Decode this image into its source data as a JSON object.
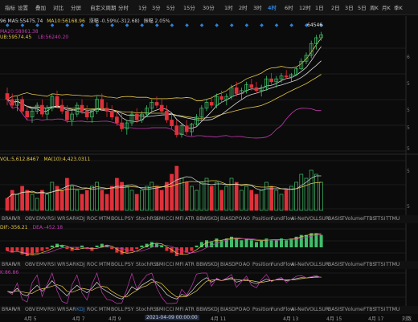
{
  "toolbar": {
    "items": [
      "指标",
      "设置",
      "叠加",
      "对比",
      "分屏",
      "自定义周期",
      "分时",
      "1分",
      "3分",
      "5分",
      "15分",
      "30分",
      "1时",
      "2时",
      "3时",
      "4时",
      "6时",
      "12时",
      "1日",
      "2日",
      "3日",
      "5日",
      "周K",
      "月K",
      "季K"
    ],
    "active": "4时"
  },
  "main_info": {
    "line1a": "96 MA5:55475.74",
    "line1b": "MA10:56168.96",
    "line1c": "涨幅 -0.59%(-312.68)",
    "line1d": "振幅 2.05%",
    "line2": "MA20:58061.38",
    "line3a": "UB:59574.45",
    "line3b": "LB:56240.20",
    "high_label": "64546"
  },
  "vol_info": {
    "a": "VOL:5,612.8467",
    "b": "MA(10):4,423.0311"
  },
  "macd_info": {
    "a": "DIF:-356.21",
    "b": "DEA:-452.18"
  },
  "kdj_info": {
    "a": "K:86.86"
  },
  "indicators": [
    "BRAR",
    "VR",
    "OBV",
    "EMV",
    "RSI",
    "WR",
    "SAR",
    "KDJ",
    "ROC",
    "MTM",
    "BOLL",
    "PSY",
    "StochRSI",
    "SMI",
    "CCI",
    "MFI",
    "ATR",
    "BBW",
    "SKDJ",
    "BIAS",
    "DPO",
    "AO",
    "Position",
    "FundFlow",
    "Ai-NetVOL",
    "LSUR",
    "BASIS",
    "TVolume",
    "FTBS",
    "TTSI",
    "TTMU"
  ],
  "ind_row1_selected": "VOL",
  "ind_row2_selected": "MACD",
  "ind_row3_selected": "KDJ",
  "yaxis": [
    "6",
    "5",
    "5",
    "5",
    "5",
    "5",
    "5"
  ],
  "dates": [
    "4月 5",
    "4月 7",
    "4月 9",
    "2021-04-09 00:00:00",
    "4月 11",
    "4月 13",
    "4月 15",
    "4月 17",
    "刘数"
  ],
  "colors": {
    "up": "#3fbf6a",
    "down": "#e0303a",
    "ma5": "#d9d9d9",
    "ma10": "#e6c84a",
    "ma20": "#c23bb0",
    "accent": "#2f7fd6"
  },
  "chart_data": {
    "type": "candlestick",
    "candles": [
      [
        60,
        61,
        58,
        59
      ],
      [
        59,
        60,
        57.5,
        58
      ],
      [
        58,
        59.5,
        57,
        59
      ],
      [
        59,
        59.5,
        56.5,
        57
      ],
      [
        57,
        58,
        55.5,
        56
      ],
      [
        56,
        57.5,
        55,
        57
      ],
      [
        57,
        58.5,
        56.5,
        58
      ],
      [
        58,
        59,
        56,
        56.5
      ],
      [
        56.5,
        58,
        55.5,
        57.5
      ],
      [
        57.5,
        60,
        57,
        59.5
      ],
      [
        59.5,
        60.5,
        57.5,
        58
      ],
      [
        58,
        59,
        56.5,
        57
      ],
      [
        57,
        58,
        55,
        55.5
      ],
      [
        55.5,
        57,
        54.5,
        56.5
      ],
      [
        56.5,
        58.5,
        56,
        58
      ],
      [
        58,
        59,
        56.5,
        57
      ],
      [
        57,
        58,
        55.5,
        56
      ],
      [
        56,
        57.5,
        55,
        57
      ],
      [
        57,
        59.5,
        56.5,
        59
      ],
      [
        59,
        60,
        57,
        57.5
      ],
      [
        57.5,
        58.5,
        56,
        57
      ],
      [
        57,
        58,
        55.5,
        56
      ],
      [
        56,
        57,
        54.5,
        55
      ],
      [
        55,
        56.5,
        53.5,
        54
      ],
      [
        54,
        55.5,
        53,
        55
      ],
      [
        55,
        57,
        54.5,
        56.5
      ],
      [
        56.5,
        57.5,
        55,
        55.5
      ],
      [
        55.5,
        57,
        55,
        56.5
      ],
      [
        56.5,
        58,
        56,
        57.5
      ],
      [
        57.5,
        59,
        57,
        58.5
      ],
      [
        58.5,
        59.5,
        57.5,
        58
      ],
      [
        58,
        59,
        56.5,
        57
      ],
      [
        57,
        58,
        55,
        55.5
      ],
      [
        55.5,
        56.5,
        54,
        54.5
      ],
      [
        54.5,
        55.5,
        52.5,
        53
      ],
      [
        53,
        55,
        52.5,
        54.5
      ],
      [
        54.5,
        55.5,
        53,
        53.5
      ],
      [
        53.5,
        55,
        52.8,
        54.8
      ],
      [
        54.8,
        56.5,
        54.5,
        56
      ],
      [
        56,
        58,
        55.5,
        57.5
      ],
      [
        57.5,
        59,
        57,
        58.5
      ],
      [
        58.5,
        59.5,
        57.5,
        58
      ],
      [
        58,
        60,
        57.5,
        59.5
      ],
      [
        59.5,
        60.5,
        58.5,
        59
      ],
      [
        59,
        60,
        58,
        59.5
      ],
      [
        59.5,
        61.5,
        59,
        61
      ],
      [
        61,
        62,
        59.5,
        60
      ],
      [
        60,
        61,
        59,
        60.5
      ],
      [
        60.5,
        62,
        60,
        61.5
      ],
      [
        61.5,
        62.5,
        60.5,
        61
      ],
      [
        61,
        62,
        60,
        60.5
      ],
      [
        60.5,
        61.5,
        59.5,
        61
      ],
      [
        61,
        63,
        60.5,
        62.5
      ],
      [
        62.5,
        63.5,
        61.5,
        62
      ],
      [
        62,
        63,
        61,
        62.5
      ],
      [
        62.5,
        63.5,
        61.8,
        63
      ],
      [
        63,
        64,
        62.5,
        62.8
      ],
      [
        62.8,
        63.5,
        62,
        63.2
      ],
      [
        63.2,
        64.5,
        63,
        64.2
      ],
      [
        64.2,
        66,
        64,
        65.5
      ],
      [
        65.5,
        67,
        65,
        66.5
      ],
      [
        66.5,
        69,
        66,
        68.5
      ],
      [
        68.5,
        70,
        67.5,
        69.5
      ],
      [
        69.5,
        70.5,
        69,
        70
      ]
    ],
    "volume": [
      3,
      5,
      4,
      6,
      5,
      4,
      3,
      5,
      4,
      7,
      6,
      5,
      8,
      6,
      5,
      4,
      5,
      6,
      7,
      5,
      4,
      6,
      8,
      7,
      6,
      5,
      4,
      5,
      6,
      7,
      6,
      5,
      7,
      9,
      11,
      8,
      7,
      6,
      5,
      7,
      8,
      6,
      7,
      5,
      6,
      8,
      7,
      5,
      6,
      5,
      4,
      5,
      7,
      6,
      5,
      4,
      5,
      6,
      7,
      9,
      8,
      10,
      9,
      7
    ],
    "macd": [
      -2,
      -3,
      -2,
      -4,
      -5,
      -4,
      -3,
      -2,
      -1,
      1,
      2,
      1,
      -1,
      -2,
      -1,
      1,
      -1,
      -2,
      1,
      2,
      1,
      -1,
      -3,
      -4,
      -3,
      -2,
      -1,
      1,
      2,
      3,
      2,
      1,
      -2,
      -3,
      -5,
      -4,
      -3,
      -2,
      1,
      3,
      4,
      3,
      5,
      4,
      5,
      6,
      5,
      4,
      5,
      4,
      3,
      4,
      5,
      4,
      4,
      5,
      4,
      5,
      6,
      7,
      7,
      8,
      8,
      7
    ],
    "kdj_k": [
      40,
      35,
      50,
      30,
      25,
      45,
      60,
      40,
      55,
      75,
      55,
      40,
      25,
      45,
      60,
      45,
      35,
      50,
      70,
      50,
      40,
      30,
      20,
      15,
      30,
      55,
      45,
      60,
      70,
      80,
      65,
      50,
      30,
      20,
      15,
      30,
      25,
      40,
      60,
      75,
      85,
      70,
      80,
      75,
      80,
      85,
      70,
      75,
      80,
      70,
      65,
      72,
      80,
      74,
      78,
      80,
      75,
      78,
      82,
      85,
      84,
      86,
      88,
      86
    ]
  }
}
